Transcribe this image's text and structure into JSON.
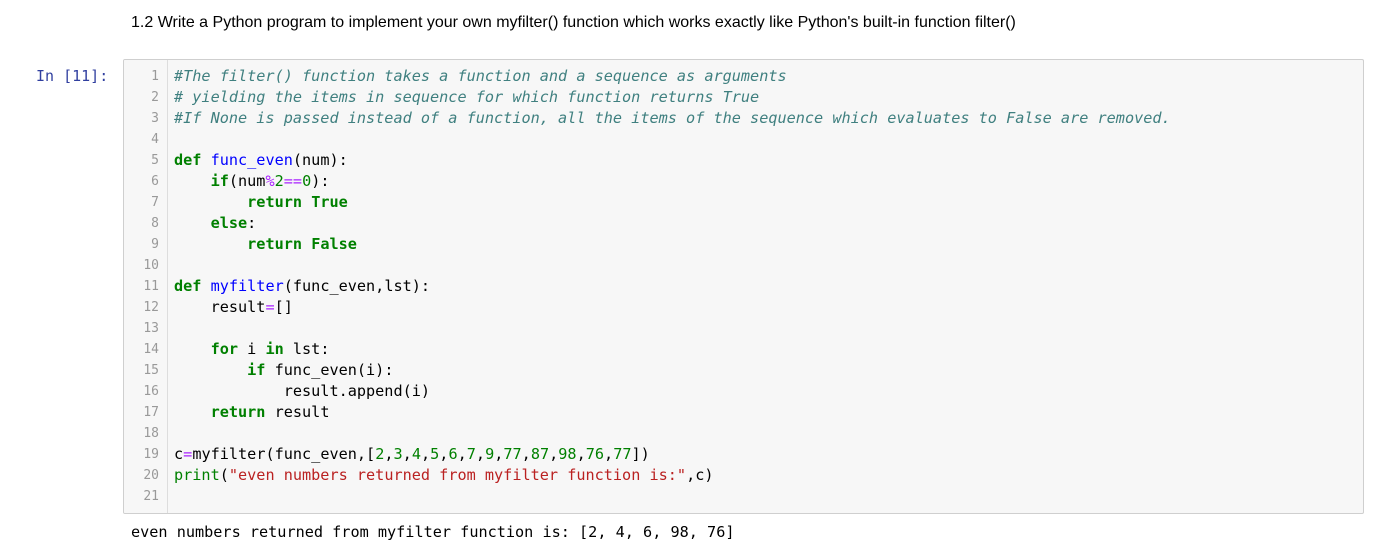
{
  "markdown": {
    "text": "1.2 Write a Python program to implement your own myfilter() function which works exactly like Python's built-in function filter()"
  },
  "cell": {
    "prompt": "In [11]:",
    "lines": [
      {
        "num": "1",
        "tokens": [
          {
            "t": "comment",
            "v": "#The filter() function takes a function and a sequence as arguments"
          }
        ]
      },
      {
        "num": "2",
        "tokens": [
          {
            "t": "comment",
            "v": "# yielding the items in sequence for which function returns True"
          }
        ]
      },
      {
        "num": "3",
        "tokens": [
          {
            "t": "comment",
            "v": "#If None is passed instead of a function, all the items of the sequence which evaluates to False are removed."
          }
        ]
      },
      {
        "num": "4",
        "tokens": []
      },
      {
        "num": "5",
        "tokens": [
          {
            "t": "keyword",
            "v": "def"
          },
          {
            "t": "plain",
            "v": " "
          },
          {
            "t": "def",
            "v": "func_even"
          },
          {
            "t": "plain",
            "v": "(num):"
          }
        ]
      },
      {
        "num": "6",
        "tokens": [
          {
            "t": "plain",
            "v": "    "
          },
          {
            "t": "keyword",
            "v": "if"
          },
          {
            "t": "plain",
            "v": "(num"
          },
          {
            "t": "op",
            "v": "%"
          },
          {
            "t": "number",
            "v": "2"
          },
          {
            "t": "op",
            "v": "=="
          },
          {
            "t": "number",
            "v": "0"
          },
          {
            "t": "plain",
            "v": "):"
          }
        ]
      },
      {
        "num": "7",
        "tokens": [
          {
            "t": "plain",
            "v": "        "
          },
          {
            "t": "keyword",
            "v": "return"
          },
          {
            "t": "plain",
            "v": " "
          },
          {
            "t": "keyword",
            "v": "True"
          }
        ]
      },
      {
        "num": "8",
        "tokens": [
          {
            "t": "plain",
            "v": "    "
          },
          {
            "t": "keyword",
            "v": "else"
          },
          {
            "t": "plain",
            "v": ":"
          }
        ]
      },
      {
        "num": "9",
        "tokens": [
          {
            "t": "plain",
            "v": "        "
          },
          {
            "t": "keyword",
            "v": "return"
          },
          {
            "t": "plain",
            "v": " "
          },
          {
            "t": "keyword",
            "v": "False"
          }
        ]
      },
      {
        "num": "10",
        "tokens": []
      },
      {
        "num": "11",
        "tokens": [
          {
            "t": "keyword",
            "v": "def"
          },
          {
            "t": "plain",
            "v": " "
          },
          {
            "t": "def",
            "v": "myfilter"
          },
          {
            "t": "plain",
            "v": "(func_even,lst):"
          }
        ]
      },
      {
        "num": "12",
        "tokens": [
          {
            "t": "plain",
            "v": "    result"
          },
          {
            "t": "op",
            "v": "="
          },
          {
            "t": "plain",
            "v": "[]"
          }
        ]
      },
      {
        "num": "13",
        "tokens": []
      },
      {
        "num": "14",
        "tokens": [
          {
            "t": "plain",
            "v": "    "
          },
          {
            "t": "keyword",
            "v": "for"
          },
          {
            "t": "plain",
            "v": " i "
          },
          {
            "t": "keyword",
            "v": "in"
          },
          {
            "t": "plain",
            "v": " lst:"
          }
        ]
      },
      {
        "num": "15",
        "tokens": [
          {
            "t": "plain",
            "v": "        "
          },
          {
            "t": "keyword",
            "v": "if"
          },
          {
            "t": "plain",
            "v": " func_even(i):"
          }
        ]
      },
      {
        "num": "16",
        "tokens": [
          {
            "t": "plain",
            "v": "            result.append(i)"
          }
        ]
      },
      {
        "num": "17",
        "tokens": [
          {
            "t": "plain",
            "v": "    "
          },
          {
            "t": "keyword",
            "v": "return"
          },
          {
            "t": "plain",
            "v": " result"
          }
        ]
      },
      {
        "num": "18",
        "tokens": []
      },
      {
        "num": "19",
        "tokens": [
          {
            "t": "plain",
            "v": "c"
          },
          {
            "t": "op",
            "v": "="
          },
          {
            "t": "plain",
            "v": "myfilter(func_even,["
          },
          {
            "t": "number",
            "v": "2"
          },
          {
            "t": "plain",
            "v": ","
          },
          {
            "t": "number",
            "v": "3"
          },
          {
            "t": "plain",
            "v": ","
          },
          {
            "t": "number",
            "v": "4"
          },
          {
            "t": "plain",
            "v": ","
          },
          {
            "t": "number",
            "v": "5"
          },
          {
            "t": "plain",
            "v": ","
          },
          {
            "t": "number",
            "v": "6"
          },
          {
            "t": "plain",
            "v": ","
          },
          {
            "t": "number",
            "v": "7"
          },
          {
            "t": "plain",
            "v": ","
          },
          {
            "t": "number",
            "v": "9"
          },
          {
            "t": "plain",
            "v": ","
          },
          {
            "t": "number",
            "v": "77"
          },
          {
            "t": "plain",
            "v": ","
          },
          {
            "t": "number",
            "v": "87"
          },
          {
            "t": "plain",
            "v": ","
          },
          {
            "t": "number",
            "v": "98"
          },
          {
            "t": "plain",
            "v": ","
          },
          {
            "t": "number",
            "v": "76"
          },
          {
            "t": "plain",
            "v": ","
          },
          {
            "t": "number",
            "v": "77"
          },
          {
            "t": "plain",
            "v": "])"
          }
        ]
      },
      {
        "num": "20",
        "tokens": [
          {
            "t": "builtin",
            "v": "print"
          },
          {
            "t": "plain",
            "v": "("
          },
          {
            "t": "string",
            "v": "\"even numbers returned from myfilter function is:\""
          },
          {
            "t": "plain",
            "v": ",c)"
          }
        ]
      },
      {
        "num": "21",
        "tokens": []
      }
    ]
  },
  "output": {
    "text": "even numbers returned from myfilter function is: [2, 4, 6, 98, 76]"
  },
  "colors": {
    "prompt": "#303F9F",
    "comment": "#408080",
    "keyword": "#008000",
    "def": "#0000ff",
    "number": "#008000",
    "operator": "#aa22ff",
    "string": "#ba2121",
    "cell_background": "#f7f7f7",
    "cell_border": "#cfcfcf"
  }
}
